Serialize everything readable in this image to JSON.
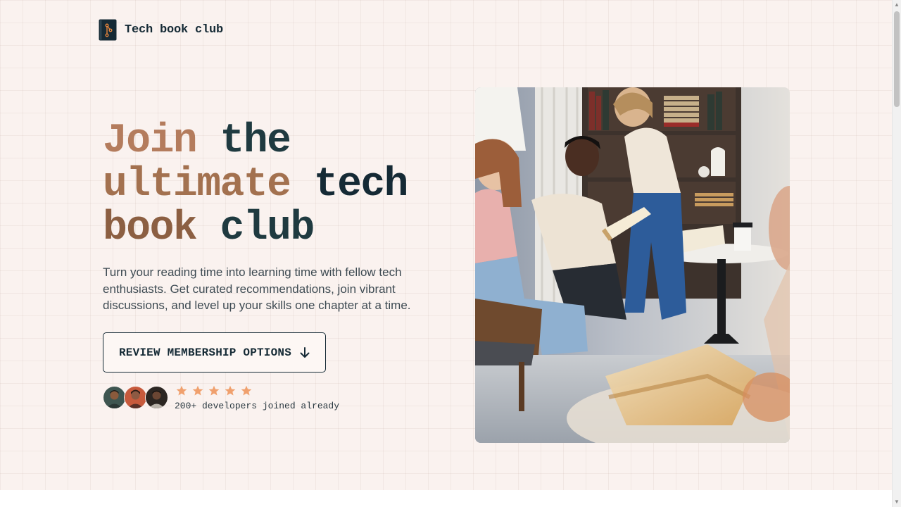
{
  "brand": {
    "name": "Tech book club",
    "icon": "book-icon"
  },
  "hero": {
    "title_lines": [
      {
        "warm": "Join",
        "dark": "the"
      },
      {
        "warm": "ultimate",
        "dark": "tech"
      },
      {
        "warm": "book",
        "dark": "club"
      }
    ],
    "description": "Turn your reading time into learning time with fellow tech enthusiasts. Get curated recommendations, join vibrant discussions, and level up your skills one chapter at a time.",
    "cta": {
      "label": "REVIEW MEMBERSHIP OPTIONS",
      "icon": "arrow-down-icon"
    },
    "rating": {
      "stars": 5,
      "max": 5,
      "color": "#f0a06d"
    },
    "social_proof": "200+ developers joined already",
    "photo": {
      "icon": "group-reading-photo"
    }
  },
  "theme": {
    "background": "#faf2ef",
    "text_dark": "#152a35",
    "accent_warm": "#b47c5d",
    "star": "#f0a06d"
  }
}
